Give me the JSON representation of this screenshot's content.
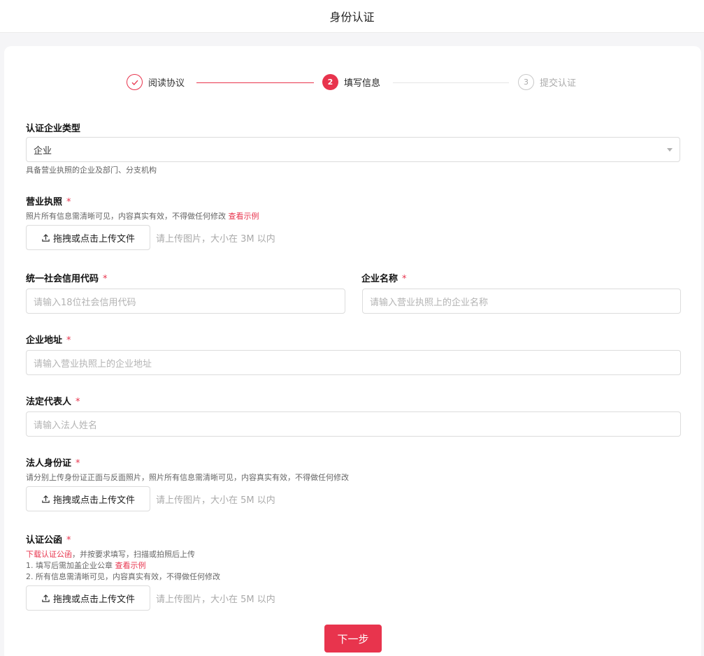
{
  "header": {
    "title": "身份认证"
  },
  "steps": [
    {
      "label": "阅读协议",
      "state": "done"
    },
    {
      "index": "2",
      "label": "填写信息",
      "state": "active"
    },
    {
      "index": "3",
      "label": "提交认证",
      "state": "pending"
    }
  ],
  "colors": {
    "accent": "#e8344d",
    "background": "#f5f5f7"
  },
  "form": {
    "company_type": {
      "label": "认证企业类型",
      "value": "企业",
      "hint": "具备营业执照的企业及部门、分支机构"
    },
    "business_license": {
      "label": "营业执照",
      "required": "*",
      "hint": "照片所有信息需清晰可见，内容真实有效，不得做任何修改",
      "example_link": "查看示例",
      "upload_label": "拖拽或点击上传文件",
      "upload_tip": "请上传图片，大小在 3M 以内"
    },
    "credit_code": {
      "label": "统一社会信用代码",
      "required": "*",
      "placeholder": "请输入18位社会信用代码"
    },
    "company_name": {
      "label": "企业名称",
      "required": "*",
      "placeholder": "请输入营业执照上的企业名称"
    },
    "company_address": {
      "label": "企业地址",
      "required": "*",
      "placeholder": "请输入营业执照上的企业地址"
    },
    "legal_rep": {
      "label": "法定代表人",
      "required": "*",
      "placeholder": "请输入法人姓名"
    },
    "legal_id": {
      "label": "法人身份证",
      "required": "*",
      "hint": "请分别上传身份证正面与反面照片，照片所有信息需清晰可见，内容真实有效，不得做任何修改",
      "upload_label": "拖拽或点击上传文件",
      "upload_tip": "请上传图片，大小在 5M 以内"
    },
    "auth_letter": {
      "label": "认证公函",
      "required": "*",
      "download_link": "下载认证公函",
      "hint_line1_rest": "，并按要求填写，扫描或拍照后上传",
      "hint_line2": "1. 填写后需加盖企业公章",
      "example_link": "查看示例",
      "hint_line3": "2. 所有信息需清晰可见，内容真实有效，不得做任何修改",
      "upload_label": "拖拽或点击上传文件",
      "upload_tip": "请上传图片，大小在 5M 以内"
    }
  },
  "actions": {
    "next_label": "下一步"
  }
}
